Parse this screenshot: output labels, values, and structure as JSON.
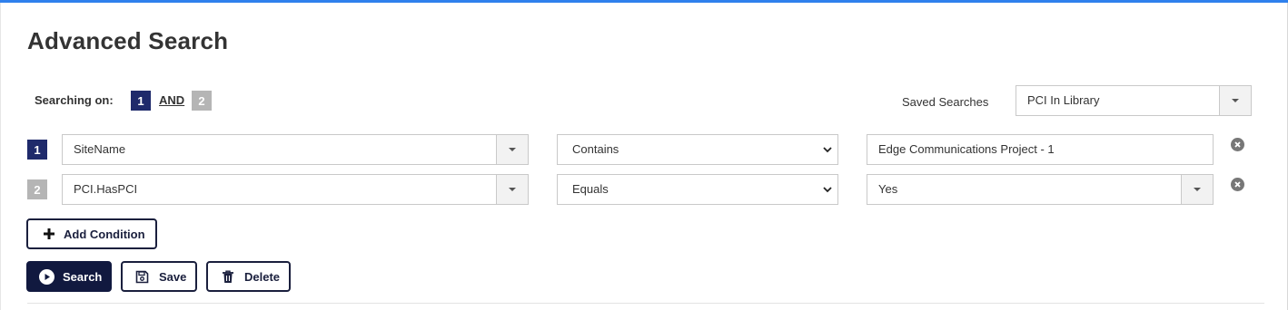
{
  "page": {
    "title": "Advanced Search"
  },
  "searching_on": {
    "label": "Searching on:",
    "chip_1": "1",
    "operator": "AND",
    "chip_2": "2"
  },
  "saved_searches": {
    "label": "Saved Searches",
    "selected": "PCI In Library"
  },
  "conditions": [
    {
      "index": "1",
      "field": "SiteName",
      "operator": "Contains",
      "value": "Edge Communications Project - 1",
      "value_type": "text"
    },
    {
      "index": "2",
      "field": "PCI.HasPCI",
      "operator": "Equals",
      "value": "Yes",
      "value_type": "dropdown"
    }
  ],
  "actions": {
    "add_condition": "Add Condition",
    "search": "Search",
    "save": "Save",
    "delete": "Delete"
  },
  "colors": {
    "accent_top": "#2f80ed",
    "navy": "#1f2a6b",
    "button_dark": "#11193f",
    "chip_inactive": "#b5b5b5"
  },
  "icons": {
    "dropdown": "caret-down-icon",
    "remove": "remove-circle-icon",
    "add": "plus-icon",
    "search": "play-circle-icon",
    "save": "floppy-disk-icon",
    "delete": "trash-icon"
  }
}
